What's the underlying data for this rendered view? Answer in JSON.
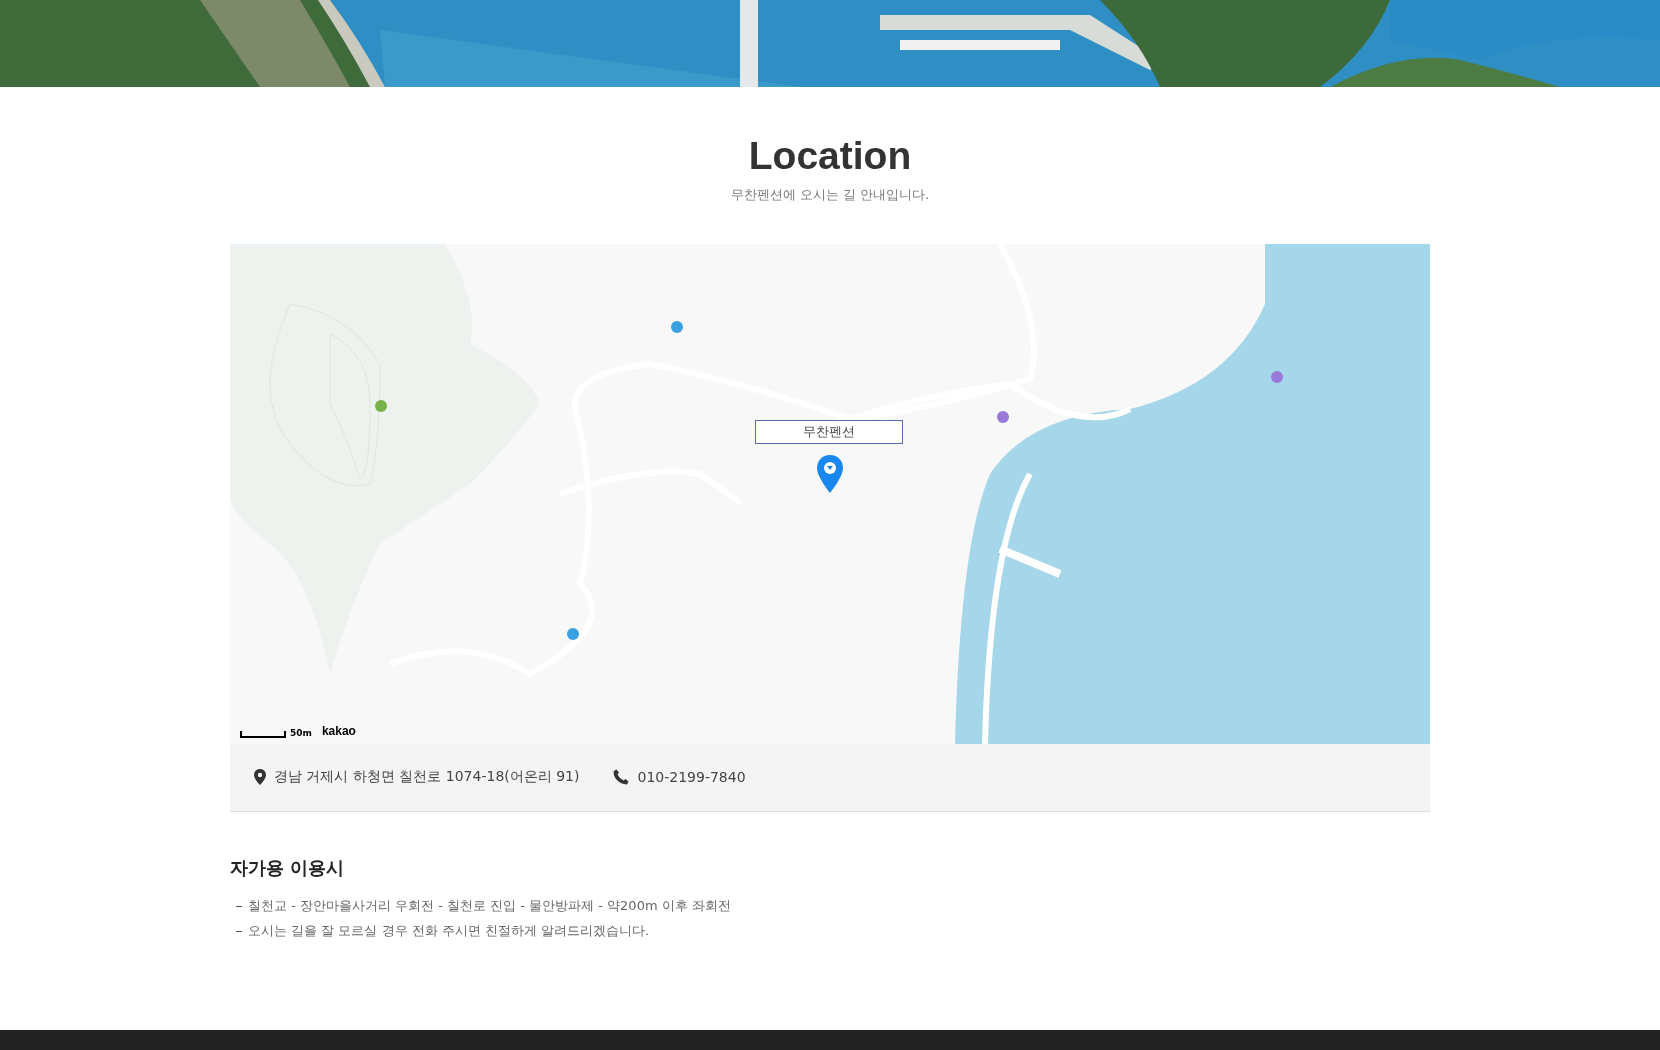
{
  "section": {
    "title": "Location",
    "subtitle": "무찬펜션에 오시는 길 안내입니다."
  },
  "map": {
    "marker_label": "무찬펜션",
    "scale": "50m",
    "brand": "kakao"
  },
  "contact": {
    "address": "경남 거제시 하청면 칠천로 1074-18(어온리 91)",
    "phone": "010-2199-7840"
  },
  "directions": {
    "title": "자가용 이용시",
    "lines": [
      "칠천교 - 장안마을사거리 우회전 - 칠천로 진입 - 물안방파제 - 약200m 이후 좌회전",
      "오시는 길을 잘 모르실 경우 전화 주시면 친절하게 알려드리겠습니다."
    ]
  }
}
